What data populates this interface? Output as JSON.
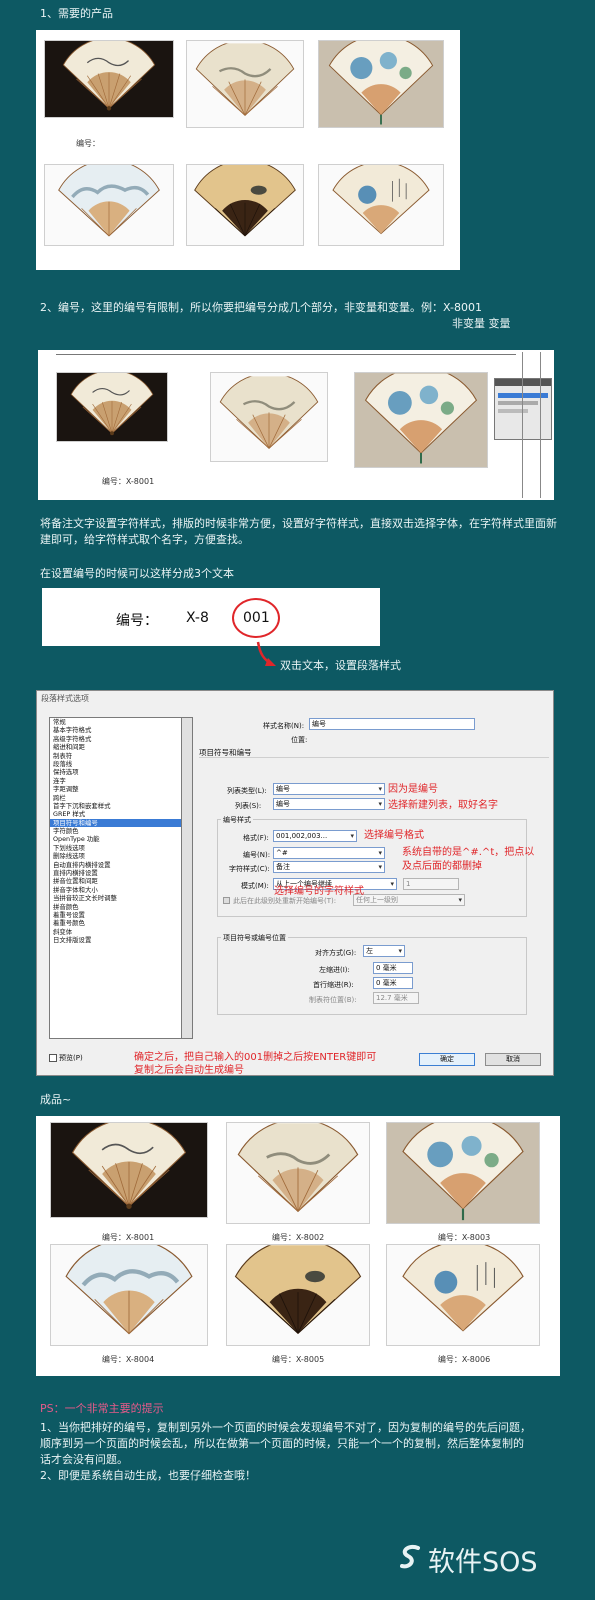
{
  "section1": {
    "heading": "1、需要的产品",
    "caption": "编号："
  },
  "section2": {
    "text": "2、编号，这里的编号有限制，所以你要把编号分成几个部分，非变量和变量。例：X-8001",
    "subtext": "非变量 变量",
    "caption": "编号：X-8001",
    "mini_panel_items": [
      "",
      "",
      "",
      "",
      ""
    ]
  },
  "para1": "将备注文字设置字符样式，排版的时候非常方便，设置好字符样式，直接双击选择字体，在字符样式里面新建即可，给字符样式取个名字，方便查找。",
  "para2": "在设置编号的时候可以这样分成3个文本",
  "demo": {
    "label": "编号：",
    "prefix": "X-8",
    "number": "001"
  },
  "arrow_note": "双击文本，设置段落样式",
  "dialog": {
    "title": "段落样式选项",
    "categories": [
      "常规",
      "基本字符格式",
      "高级字符格式",
      "缩进和间距",
      "制表符",
      "段落线",
      "保持选项",
      "连字",
      "字距调整",
      "跨栏",
      "首字下沉和嵌套样式",
      "GREP 样式",
      "项目符号和编号",
      "字符颜色",
      "OpenType 功能",
      "下划线选项",
      "删除线选项",
      "自动直排内横排设置",
      "直排内横排设置",
      "拼音位置和间距",
      "拼音字体和大小",
      "当拼音较正文长时调整",
      "拼音颜色",
      "着重号设置",
      "着重号颜色",
      "斜变体",
      "日文排版设置"
    ],
    "selected_index": 12,
    "style_name_label": "样式名称(N):",
    "style_name_value": "编号",
    "position_label": "位置:",
    "section_title": "项目符号和编号",
    "list_type_label": "列表类型(L):",
    "list_type_value": "编号",
    "list_label": "列表(S):",
    "list_value": "编号",
    "numbering_style_title": "编号样式",
    "format_label": "格式(F):",
    "format_value": "001,002,003...",
    "number_label": "编号(N):",
    "number_value": "^#",
    "char_style_label": "字符样式(C):",
    "char_style_value": "备注",
    "mode_label": "模式(M):",
    "mode_value": "从上一个编号继续",
    "mode_num": "1",
    "restart_label": "此后在此级别处重新开始编号(T):",
    "restart_value": "任何上一级别",
    "position_group_title": "项目符号或编号位置",
    "align_label": "对齐方式(G):",
    "align_value": "左",
    "left_indent_label": "左缩进(I):",
    "left_indent_value": "0 毫米",
    "first_indent_label": "首行缩进(R):",
    "first_indent_value": "0 毫米",
    "tab_label": "制表符位置(B):",
    "tab_value": "12.7 毫米",
    "preview_label": "预览(P)",
    "ok_label": "确定",
    "cancel_label": "取消"
  },
  "annotations": {
    "a1": "因为是编号",
    "a2": "选择新建列表，取好名字",
    "a3": "选择编号格式",
    "a4": "系统自带的是^#.^t，把点以",
    "a5": "及点后面的都删掉",
    "a6": "选择编号的字符样式",
    "a7": "确定之后，把自己输入的001删掉之后按ENTER键即可",
    "a8": "复制之后会自动生成编号"
  },
  "result_title": "成品~",
  "result_captions": [
    "编号：X-8001",
    "编号：X-8002",
    "编号：X-8003",
    "编号：X-8004",
    "编号：X-8005",
    "编号：X-8006"
  ],
  "ps": {
    "title": "PS：一个非常主要的提示",
    "lines": [
      "1、当你把排好的编号，复制到另外一个页面的时候会发现编号不对了，因为复制的编号的先后问题，",
      "顺序到另一个页面的时候会乱，所以在做第一个页面的时候，只能一个一个的复制，然后整体复制的",
      "话才会没有问题。",
      "2、即便是系统自动生成，也要仔细检查哦！"
    ]
  },
  "watermark": "软件SOS",
  "colors": {
    "background": "#0d5963",
    "annotation": "#e0262a",
    "ps_title": "#e65a8a",
    "selected": "#3a7bd5"
  }
}
